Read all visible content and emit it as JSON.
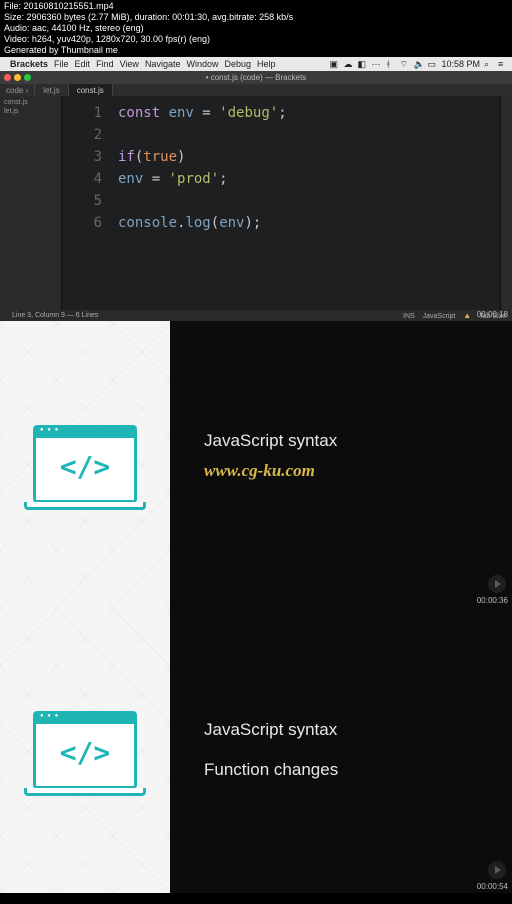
{
  "meta": {
    "file": "File: 20160810215551.mp4",
    "size": "Size: 2906360 bytes (2.77 MiB), duration: 00:01:30, avg.bitrate: 258 kb/s",
    "audio": "Audio: aac, 44100 Hz, stereo (eng)",
    "video": "Video: h264, yuv420p, 1280x720, 30.00 fps(r) (eng)",
    "gen": "Generated by Thumbnail me"
  },
  "macbar": {
    "apple": "",
    "app": "Brackets",
    "items": [
      "File",
      "Edit",
      "Find",
      "View",
      "Navigate",
      "Window",
      "Debug",
      "Help"
    ],
    "clock": "10:58 PM"
  },
  "window": {
    "title": "• const.js (code) — Brackets"
  },
  "tabs": {
    "seg": "code ›",
    "items": [
      {
        "label": "let.js",
        "active": false
      },
      {
        "label": "const.js",
        "active": true
      }
    ]
  },
  "sidebar_files": [
    "const.js",
    "let.js"
  ],
  "code_lines": [
    {
      "n": "1",
      "tokens": [
        {
          "t": "const ",
          "c": "kw"
        },
        {
          "t": "env",
          "c": "var"
        },
        {
          "t": " = ",
          "c": "op"
        },
        {
          "t": "'debug'",
          "c": "str"
        },
        {
          "t": ";",
          "c": "punc"
        }
      ]
    },
    {
      "n": "2",
      "tokens": []
    },
    {
      "n": "3",
      "tokens": [
        {
          "t": "if",
          "c": "kw"
        },
        {
          "t": "(",
          "c": "punc"
        },
        {
          "t": "true",
          "c": "bool"
        },
        {
          "t": ")",
          "c": "punc"
        }
      ]
    },
    {
      "n": "4",
      "tokens": [
        {
          "t": "env",
          "c": "var"
        },
        {
          "t": " = ",
          "c": "op"
        },
        {
          "t": "'prod'",
          "c": "str"
        },
        {
          "t": ";",
          "c": "punc"
        }
      ]
    },
    {
      "n": "5",
      "tokens": []
    },
    {
      "n": "6",
      "tokens": [
        {
          "t": "console",
          "c": "var"
        },
        {
          "t": ".",
          "c": "punc"
        },
        {
          "t": "log",
          "c": "fn"
        },
        {
          "t": "(",
          "c": "punc"
        },
        {
          "t": "env",
          "c": "var"
        },
        {
          "t": ");",
          "c": "punc"
        }
      ]
    }
  ],
  "status": {
    "left": "Line 3, Column 9 — 6 Lines",
    "ins": "INS",
    "lang": "JavaScript",
    "spaces": "Tab Size"
  },
  "timestamps": {
    "t1": "00:00:18",
    "t2": "00:00:36",
    "t3": "00:00:54"
  },
  "slide1": {
    "line1": "JavaScript syntax",
    "watermark": "www.cg-ku.com"
  },
  "slide2": {
    "line1": "JavaScript syntax",
    "line2": "Function changes"
  },
  "code_glyph": "</>"
}
